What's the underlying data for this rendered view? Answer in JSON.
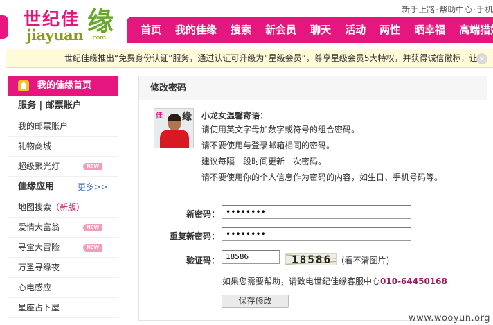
{
  "logo": {
    "cn": "世纪佳",
    "yuan": "缘",
    "en": "jiayuan",
    "com": ".com"
  },
  "top_links": {
    "newbie": "新手上路",
    "help": "帮助中心",
    "mobile": "手机",
    "sep": "·"
  },
  "nav": [
    "首页",
    "我的佳缘",
    "搜索",
    "新会员",
    "聊天",
    "活动",
    "两性",
    "晒幸福",
    "高端猎婚"
  ],
  "notice": {
    "text": "世纪佳缘推出“免费身份认证”服务，通过认证可升级为“星级会员”，尊享星级会员5大特权，并获得诚信徽标，让",
    "close": "×"
  },
  "sidebar": {
    "header": "我的佳缘首页",
    "section1": "服务  |  邮票账户",
    "items1": [
      {
        "label": "我的邮票账户"
      },
      {
        "label": "礼物商城"
      },
      {
        "label": "超级聚光灯",
        "badge": "NEW"
      }
    ],
    "section2": "佳缘应用",
    "more": "更多>>",
    "items2": [
      {
        "label": "地图搜索",
        "extra": "（新版）"
      },
      {
        "label": "爱情大富翁",
        "badge": "NEW"
      },
      {
        "label": "寻宝大冒险",
        "badge": "NEW"
      },
      {
        "label": "万圣寻缘夜"
      },
      {
        "label": "心电感应"
      },
      {
        "label": "星座占卜屋"
      }
    ]
  },
  "panel": {
    "title": "修改密码",
    "avatar_corner": "缘",
    "avatar_mark": "佳",
    "tips_title": "小龙女温馨寄语：",
    "tips": [
      "请使用英文字母加数字或符号的组合密码。",
      "请不要使用与登录邮箱相同的密码。",
      "建议每隔一段时间更新一次密码。",
      "请不要使用你的个人信息作为密码的内容，如生日、手机号码等。"
    ],
    "new_pw_label": "新密码：",
    "new_pw_value": "••••••••",
    "confirm_pw_label": "重复新密码：",
    "confirm_pw_value": "••••••••",
    "captcha_label": "验证码：",
    "captcha_value": "18586",
    "captcha_image_text": "18586",
    "captcha_refresh": "(看不清图片)",
    "help_text": "如果您需要帮助，请致电世纪佳缘客服中心",
    "help_phone": "010-64450168",
    "save_label": "保存修改"
  },
  "watermark": "www.wooyun.org",
  "colors": {
    "brand_pink": "#e6167f",
    "notice_bg": "#fffbd9",
    "phone": "#a0175f",
    "logo_green": "#8b9b10"
  }
}
